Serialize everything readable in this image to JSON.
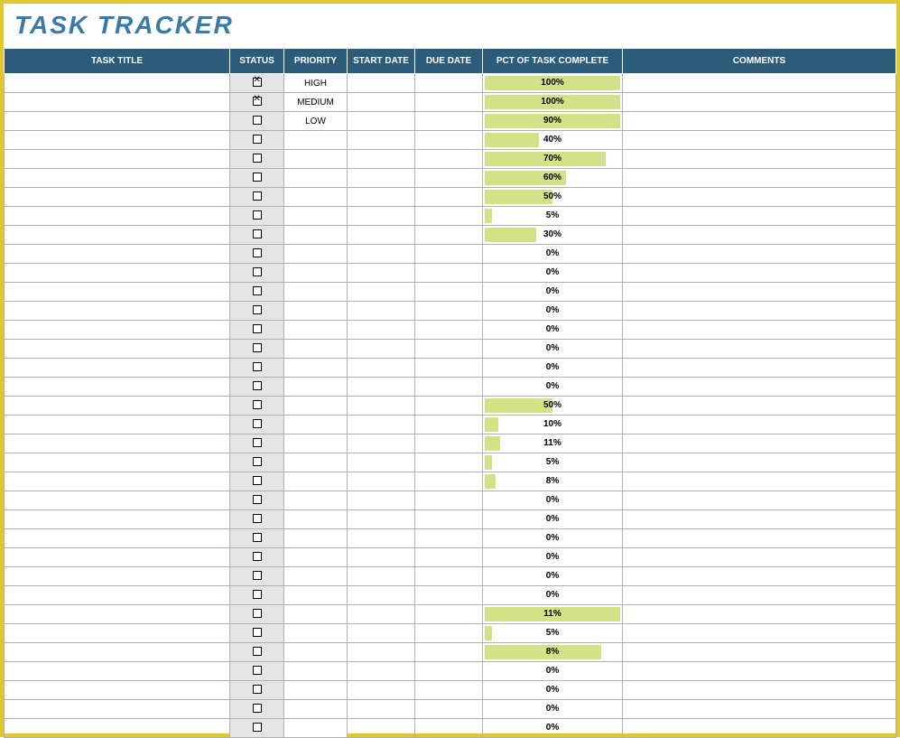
{
  "title": "TASK TRACKER",
  "headers": {
    "task_title": "TASK TITLE",
    "status": "STATUS",
    "priority": "PRIORITY",
    "start_date": "START DATE",
    "due_date": "DUE DATE",
    "pct": "PCT OF TASK COMPLETE",
    "comments": "COMMENTS"
  },
  "rows": [
    {
      "task": "",
      "checked": true,
      "priority": "HIGH",
      "start": "",
      "due": "",
      "pct": 100,
      "bar": 100,
      "comments": ""
    },
    {
      "task": "",
      "checked": true,
      "priority": "MEDIUM",
      "start": "",
      "due": "",
      "pct": 100,
      "bar": 100,
      "comments": ""
    },
    {
      "task": "",
      "checked": false,
      "priority": "LOW",
      "start": "",
      "due": "",
      "pct": 90,
      "bar": 115,
      "comments": ""
    },
    {
      "task": "",
      "checked": false,
      "priority": "",
      "start": "",
      "due": "",
      "pct": 40,
      "bar": 40,
      "comments": ""
    },
    {
      "task": "",
      "checked": false,
      "priority": "",
      "start": "",
      "due": "",
      "pct": 70,
      "bar": 89,
      "comments": ""
    },
    {
      "task": "",
      "checked": false,
      "priority": "",
      "start": "",
      "due": "",
      "pct": 60,
      "bar": 60,
      "comments": ""
    },
    {
      "task": "",
      "checked": false,
      "priority": "",
      "start": "",
      "due": "",
      "pct": 50,
      "bar": 50,
      "comments": ""
    },
    {
      "task": "",
      "checked": false,
      "priority": "",
      "start": "",
      "due": "",
      "pct": 5,
      "bar": 5,
      "comments": ""
    },
    {
      "task": "",
      "checked": false,
      "priority": "",
      "start": "",
      "due": "",
      "pct": 30,
      "bar": 38,
      "comments": ""
    },
    {
      "task": "",
      "checked": false,
      "priority": "",
      "start": "",
      "due": "",
      "pct": 0,
      "bar": 0,
      "comments": ""
    },
    {
      "task": "",
      "checked": false,
      "priority": "",
      "start": "",
      "due": "",
      "pct": 0,
      "bar": 0,
      "comments": ""
    },
    {
      "task": "",
      "checked": false,
      "priority": "",
      "start": "",
      "due": "",
      "pct": 0,
      "bar": 0,
      "comments": ""
    },
    {
      "task": "",
      "checked": false,
      "priority": "",
      "start": "",
      "due": "",
      "pct": 0,
      "bar": 0,
      "comments": ""
    },
    {
      "task": "",
      "checked": false,
      "priority": "",
      "start": "",
      "due": "",
      "pct": 0,
      "bar": 0,
      "comments": ""
    },
    {
      "task": "",
      "checked": false,
      "priority": "",
      "start": "",
      "due": "",
      "pct": 0,
      "bar": 0,
      "comments": ""
    },
    {
      "task": "",
      "checked": false,
      "priority": "",
      "start": "",
      "due": "",
      "pct": 0,
      "bar": 0,
      "comments": ""
    },
    {
      "task": "",
      "checked": false,
      "priority": "",
      "start": "",
      "due": "",
      "pct": 0,
      "bar": 0,
      "comments": ""
    },
    {
      "task": "",
      "checked": false,
      "priority": "",
      "start": "",
      "due": "",
      "pct": 50,
      "bar": 50,
      "comments": ""
    },
    {
      "task": "",
      "checked": false,
      "priority": "",
      "start": "",
      "due": "",
      "pct": 10,
      "bar": 10,
      "comments": ""
    },
    {
      "task": "",
      "checked": false,
      "priority": "",
      "start": "",
      "due": "",
      "pct": 11,
      "bar": 11,
      "comments": ""
    },
    {
      "task": "",
      "checked": false,
      "priority": "",
      "start": "",
      "due": "",
      "pct": 5,
      "bar": 5,
      "comments": ""
    },
    {
      "task": "",
      "checked": false,
      "priority": "",
      "start": "",
      "due": "",
      "pct": 8,
      "bar": 8,
      "comments": ""
    },
    {
      "task": "",
      "checked": false,
      "priority": "",
      "start": "",
      "due": "",
      "pct": 0,
      "bar": 0,
      "comments": ""
    },
    {
      "task": "",
      "checked": false,
      "priority": "",
      "start": "",
      "due": "",
      "pct": 0,
      "bar": 0,
      "comments": ""
    },
    {
      "task": "",
      "checked": false,
      "priority": "",
      "start": "",
      "due": "",
      "pct": 0,
      "bar": 0,
      "comments": ""
    },
    {
      "task": "",
      "checked": false,
      "priority": "",
      "start": "",
      "due": "",
      "pct": 0,
      "bar": 0,
      "comments": ""
    },
    {
      "task": "",
      "checked": false,
      "priority": "",
      "start": "",
      "due": "",
      "pct": 0,
      "bar": 0,
      "comments": ""
    },
    {
      "task": "",
      "checked": false,
      "priority": "",
      "start": "",
      "due": "",
      "pct": 0,
      "bar": 0,
      "comments": ""
    },
    {
      "task": "",
      "checked": false,
      "priority": "",
      "start": "",
      "due": "",
      "pct": 11,
      "bar": 112,
      "comments": ""
    },
    {
      "task": "",
      "checked": false,
      "priority": "",
      "start": "",
      "due": "",
      "pct": 5,
      "bar": 5,
      "comments": ""
    },
    {
      "task": "",
      "checked": false,
      "priority": "",
      "start": "",
      "due": "",
      "pct": 8,
      "bar": 86,
      "comments": ""
    },
    {
      "task": "",
      "checked": false,
      "priority": "",
      "start": "",
      "due": "",
      "pct": 0,
      "bar": 0,
      "comments": ""
    },
    {
      "task": "",
      "checked": false,
      "priority": "",
      "start": "",
      "due": "",
      "pct": 0,
      "bar": 0,
      "comments": ""
    },
    {
      "task": "",
      "checked": false,
      "priority": "",
      "start": "",
      "due": "",
      "pct": 0,
      "bar": 0,
      "comments": ""
    },
    {
      "task": "",
      "checked": false,
      "priority": "",
      "start": "",
      "due": "",
      "pct": 0,
      "bar": 0,
      "comments": ""
    }
  ]
}
